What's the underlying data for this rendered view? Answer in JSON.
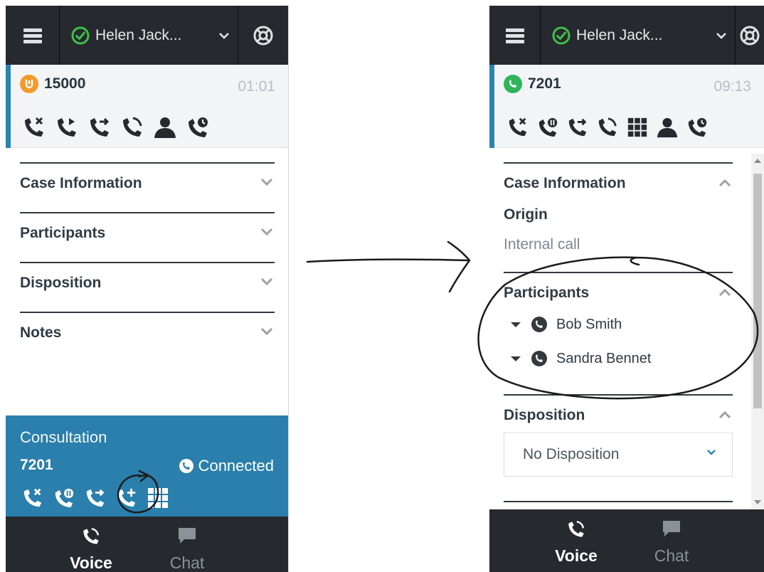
{
  "colors": {
    "topbar": "#262a2e",
    "accent_blue": "#2b83b0",
    "consult_bg": "#2a7fac",
    "status_ready": "#3fbf4a",
    "status_hold": "#f39a2b",
    "status_talk": "#2fb45a"
  },
  "left": {
    "agent_name": "Helen Jack...",
    "call": {
      "number": "15000",
      "timer": "01:01",
      "status_icon": "call-on-hold-icon"
    },
    "call_actions": [
      "end-call-icon",
      "resume-call-icon",
      "transfer-call-icon",
      "conference-call-icon",
      "consult-icon",
      "schedule-callback-icon"
    ],
    "sections": [
      "Case Information",
      "Participants",
      "Disposition",
      "Notes"
    ],
    "consultation": {
      "title": "Consultation",
      "number": "7201",
      "status": "Connected",
      "actions": [
        "end-consult-icon",
        "hold-consult-icon",
        "transfer-consult-icon",
        "conference-consult-icon",
        "keypad-icon"
      ]
    },
    "tabs": {
      "voice": "Voice",
      "chat": "Chat"
    }
  },
  "right": {
    "agent_name": "Helen Jack...",
    "call": {
      "number": "7201",
      "timer": "09:13",
      "status_icon": "call-connected-icon"
    },
    "call_actions": [
      "end-call-icon",
      "hold-call-icon",
      "transfer-call-icon",
      "conference-call-icon",
      "keypad-icon",
      "consult-icon",
      "schedule-callback-icon"
    ],
    "case_information": {
      "title": "Case Information",
      "origin_label": "Origin",
      "origin_value": "Internal call"
    },
    "participants": {
      "title": "Participants",
      "items": [
        "Bob Smith",
        "Sandra Bennet"
      ]
    },
    "disposition": {
      "title": "Disposition",
      "selected": "No Disposition"
    },
    "tabs": {
      "voice": "Voice",
      "chat": "Chat"
    }
  }
}
